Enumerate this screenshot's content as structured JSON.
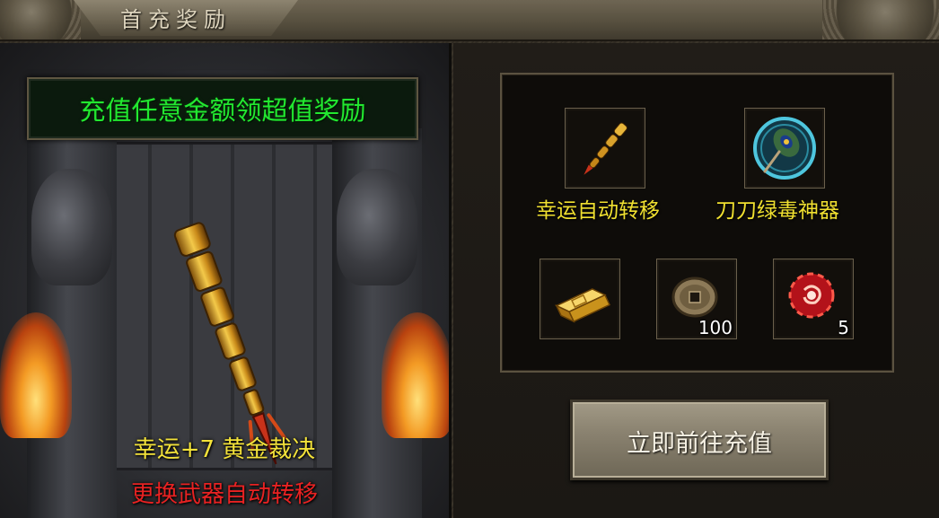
{
  "window": {
    "title": "首充奖励"
  },
  "promo": {
    "banner": "充值任意金额领超值奖励",
    "weapon_name": "幸运+7 黄金裁决",
    "weapon_subtitle": "更换武器自动转移"
  },
  "rewards": {
    "featured": [
      {
        "label": "幸运自动转移",
        "icon": "golden-sword-icon"
      },
      {
        "label": "刀刀绿毒神器",
        "icon": "peacock-feather-icon"
      }
    ],
    "items": [
      {
        "icon": "gold-bar-icon",
        "count": ""
      },
      {
        "icon": "coin-icon",
        "count": "100"
      },
      {
        "icon": "red-orb-icon",
        "count": "5"
      }
    ]
  },
  "actions": {
    "recharge_label": "立即前往充值"
  },
  "colors": {
    "banner_text": "#22e830",
    "weapon_name": "#f3e23a",
    "weapon_subtitle": "#e82222",
    "item_label": "#f0e030"
  }
}
